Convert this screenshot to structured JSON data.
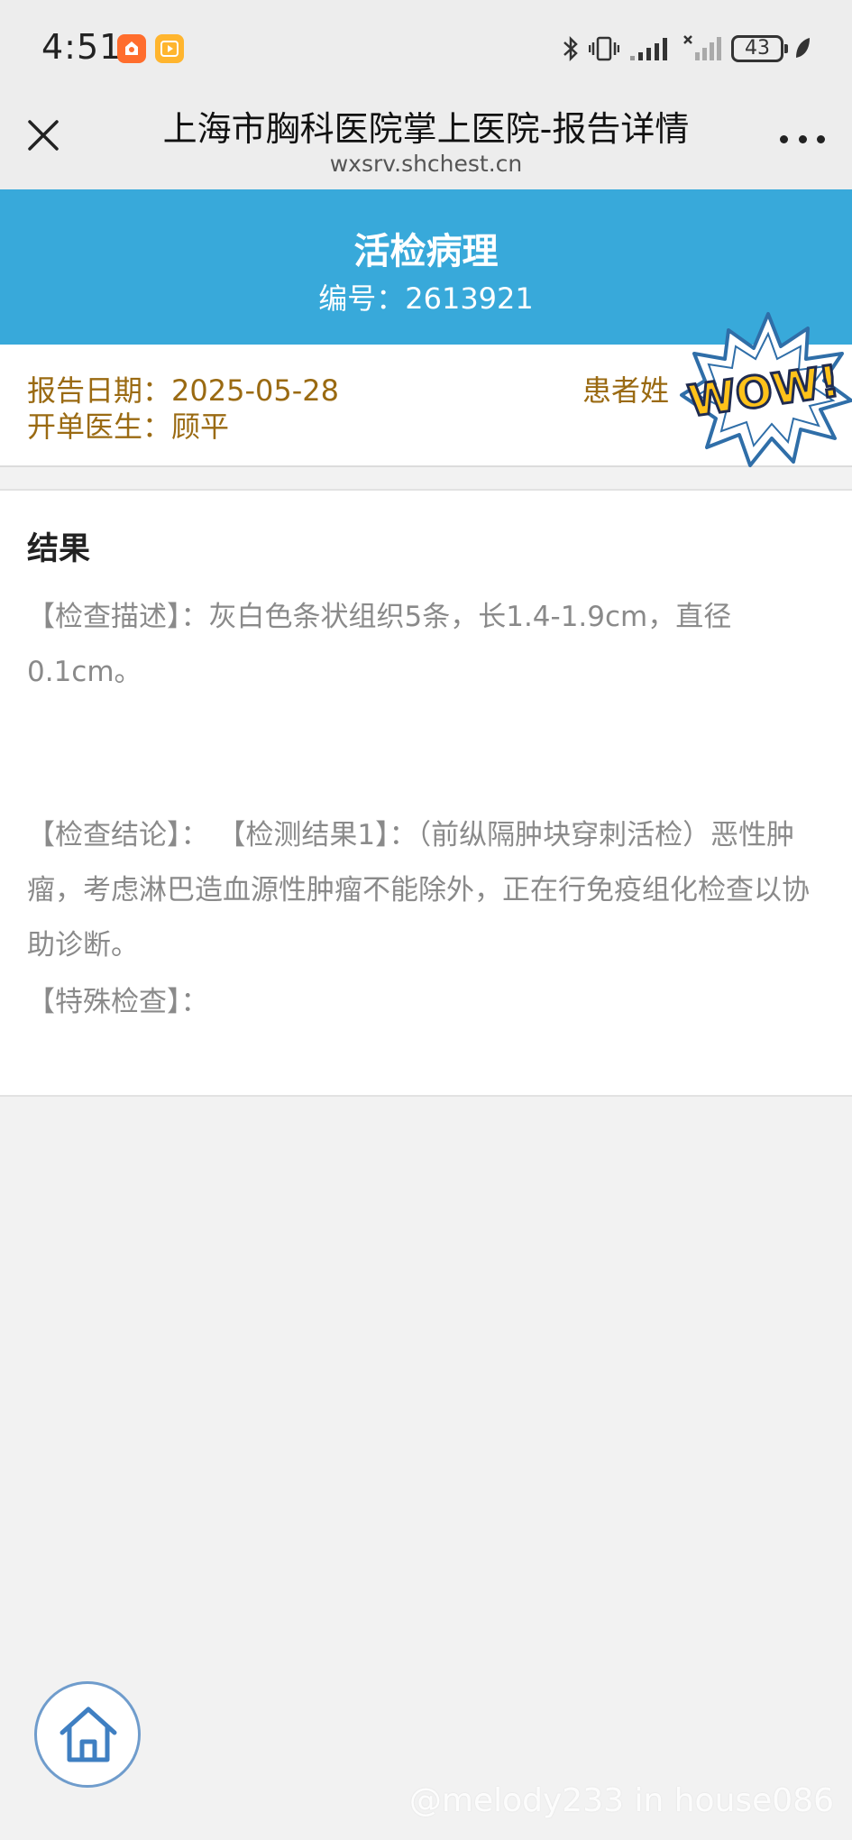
{
  "status_bar": {
    "time": "4:51",
    "battery": "43",
    "icons": [
      "bluetooth-icon",
      "vibrate-icon",
      "signal-icon",
      "signal-off-icon",
      "battery-icon",
      "leaf-icon"
    ]
  },
  "nav": {
    "title": "上海市胸科医院掌上医院-报告详情",
    "subtitle": "wxsrv.shchest.cn"
  },
  "header": {
    "title": "活检病理",
    "number": "编号：2613921"
  },
  "info": {
    "report_date": "报告日期：2025-05-28",
    "doctor": "开单医生：顾平",
    "patient_label": "患者姓",
    "sticker_text": "WOW!"
  },
  "result": {
    "heading": "结果",
    "description": "【检查描述】：灰白色条状组织5条，长1.4-1.9cm，直径0.1cm。",
    "conclusion": "【检查结论】：  【检测结果1】：（前纵隔肿块穿刺活检）恶性肿瘤，考虑淋巴造血源性肿瘤不能除外，正在行免疫组化检查以协助诊断。",
    "special": "【特殊检查】："
  },
  "watermark": "@melody233 in house086",
  "colors": {
    "header_blue": "#38a9da",
    "info_gold": "#9a6a12",
    "body_gray": "#8a8a8a"
  }
}
